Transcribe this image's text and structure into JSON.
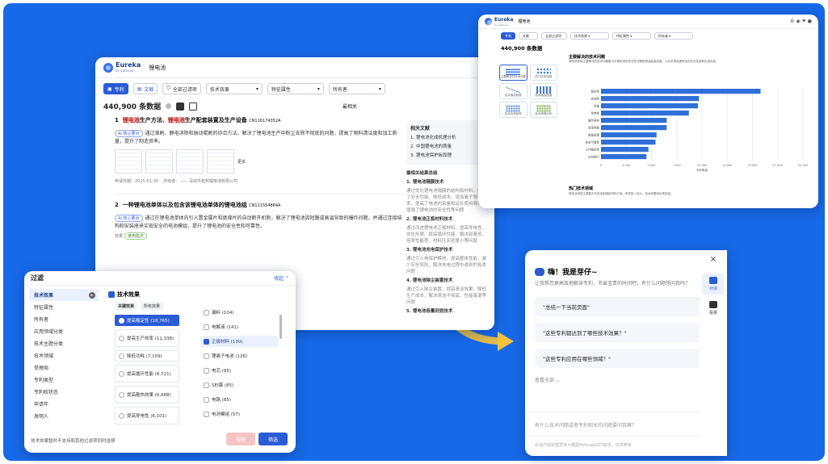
{
  "main": {
    "brand": "Eureka",
    "brand_sub": "by patsnap",
    "search": "锂电池",
    "toolbar": {
      "patent": "专利",
      "literature": "文献",
      "filter": "全部过滤项",
      "effect": "技术效果",
      "feature": "特征属性",
      "owner": "所有者"
    },
    "count": "440,900 条数据",
    "sort": "最相关",
    "r1": {
      "num": "1",
      "title_pre": "锂电池",
      "title_mid": "生产方法、",
      "title_hl2": "锂电池",
      "title_post": "生产配套装置及生产设备",
      "pn": "CN116174352A",
      "ai": "AI 核心要点",
      "body": "通过滚刷、静电消除和振动辊刷的协合方法，解决了锂电池生产中粉尘去除不彻底的问题，提高了物料清洁度和加工质量，提升了制造良率。",
      "more": "更多",
      "date": "申请日期：2025-01-30",
      "owner": "所有者：—— 深圳市拓邦锂电池有限公司"
    },
    "r2": {
      "num": "2",
      "title": "一种锂电池单体以及包含该锂电池单体的锂电池组",
      "pn": "CN111554864A",
      "ai": "AI 核心要点",
      "body": "通过在锂电池单体内引入置金属片和绝缘片的自动断开机制，解决了锂电池因短路或高温导致的爆炸问题，并通过连接结构和安装座来实现安全的电池模组，提升了锂电池的安全性和可靠性。",
      "tag1": "效果",
      "tag2": "使用稳定"
    },
    "side": {
      "related": "相关文献",
      "l1": "1. 锂电池化成机理分析",
      "l2": "2. 中国锂电池的质量",
      "l3": "3. 锂电池保护板原理",
      "hdr2": "最相关结果总结",
      "s1": "1. 锂电池隔膜技术",
      "s1b": "通过优化锂电池隔膜的结构和材料，提高了安全性能、降低成本、增加离子导电率，提高了电池的容量和延长使用寿命，增强了锂电池的安全性等问题",
      "s2": "2. 锂电池正极材料技术",
      "s2b": "通过改进锂电池正极材料，提高导电性、优化形貌、提高循环性能、解决容量低、倍率性能差、材料压实密度小等问题",
      "s3": "3. 锂电池充电保护技术",
      "s3b": "通过引入电保护模块，提高整体性能，减少安全风险，解决充电过程中遇到的各类问题",
      "s4": "4. 锂电池除尘装置技术",
      "s4b": "通过引入除尘装置，提高清洁效果，降低生产成本，解决清洁不彻底、性能衰退等问题",
      "s5": "5. 锂电池容量刻划技术",
      "src": "来自专利：",
      "refs": "[1] [2] [3] [4] [5]"
    }
  },
  "chart": {
    "brand": "Eureka",
    "brand_sub": "by patsnap",
    "search": "锂电池",
    "count": "440,900 条数据",
    "title": "主要解决的技术问题",
    "subtitle": "锂电池领域主要解决的技术问题集中在锂电池的安全性问题和提高能量密度，以此来提高锂电池的安全性能和实用性能。",
    "tools": [
      "主要解决的技术问题",
      "热门技术领域",
      "技术演变趋势",
      "技术路线图谱",
      "技术功效矩阵",
      "技术领域分布"
    ],
    "bottom_title": "热门技术领域",
    "bottom_desc": "锂电池领域主要集中在电池制造和材料方面，研发投入较大，技术成果转化率较高。"
  },
  "chart_data": {
    "type": "bar",
    "orientation": "horizontal",
    "categories": [
      "稳定性",
      "安全性",
      "容量",
      "导电性",
      "循环寿命",
      "倍率性能",
      "能量密度",
      "安全可靠性",
      "工作稳定性",
      "过充能力"
    ],
    "values": [
      15800,
      9700,
      9600,
      8700,
      6500,
      6500,
      5500,
      5400,
      4700,
      4500
    ],
    "xticks": [
      "0",
      "2,500",
      "5,000",
      "7,500",
      "10,000",
      "12,500",
      "15,000",
      "17,500",
      "20,000"
    ],
    "xlim": [
      0,
      20000
    ],
    "xlabel": "专利数量"
  },
  "filter": {
    "title": "过滤",
    "collapse": "收起 ⌃",
    "cats": [
      "技术效果",
      "特征属性",
      "所有者",
      "应用领域分类",
      "技术主题分类",
      "技术领域",
      "受理局",
      "专利类型",
      "专利权状态",
      "申请年",
      "发明人"
    ],
    "head": "技术效果",
    "tab1": "关键效果",
    "tab2": "所有效果",
    "col1": [
      "提高稳定性 (18,765)",
      "提高生产效率 (11,338)",
      "降低功耗 (7,109)",
      "提高循环性能 (6,721)",
      "提高散热效果 (6,688)",
      "提高导电性 (6,101)"
    ],
    "col2": [
      "漏料 (104)",
      "电解液 (141)",
      "正极材料 (130)",
      "锂离子电池 (126)",
      "电芯 (95)",
      "SEI膜 (85)",
      "电路 (85)",
      "电池模组 (57)"
    ],
    "footer": "技术效果暂时不支持和其他过滤项同时选择",
    "clear": "排除",
    "apply": "筛选"
  },
  "chat": {
    "greet": "嗨！我是芽仔~",
    "intro": "让我帮您更高效地解读专利，节省宝贵的时间吧，有什么问题想问我吗？",
    "q1": "\"总结一下当前页面\"",
    "q2": "\"这些专利都达到了哪些技术效果？\"",
    "q3": "\"这些专利应用在哪些领域？\"",
    "all": "查看全部",
    "input_ph": "有什么技术问题或者专利相关的问题要问我嘛？",
    "footnote": "对话内容由智慧芽大模型PatsnapGPT提供，仅供参考",
    "rail1": "对话",
    "rail2": "投票",
    "close": "×"
  },
  "colors": {
    "bg": "#1769e7",
    "accent": "#2a5cd6",
    "bar": "#2f6fd8",
    "arrow": "#f5c33b"
  }
}
